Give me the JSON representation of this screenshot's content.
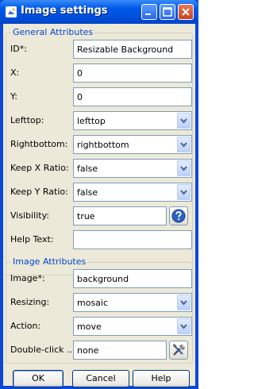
{
  "window": {
    "title": "Image settings"
  },
  "general": {
    "legend": "General Attributes",
    "id": {
      "label": "ID*:",
      "value": "Resizable Background"
    },
    "x": {
      "label": "X:",
      "value": "0"
    },
    "y": {
      "label": "Y:",
      "value": "0"
    },
    "lefttop": {
      "label": "Lefttop:",
      "value": "lefttop"
    },
    "rightbottom": {
      "label": "Rightbottom:",
      "value": "rightbottom"
    },
    "keepx": {
      "label": "Keep X Ratio:",
      "value": "false"
    },
    "keepy": {
      "label": "Keep Y Ratio:",
      "value": "false"
    },
    "visibility": {
      "label": "Visibility:",
      "value": "true",
      "icon": "help-icon"
    },
    "helptext": {
      "label": "Help Text:",
      "value": ""
    }
  },
  "image": {
    "legend": "Image Attributes",
    "image": {
      "label": "Image*:",
      "value": "background"
    },
    "resizing": {
      "label": "Resizing:",
      "value": "mosaic"
    },
    "action": {
      "label": "Action:",
      "value": "move"
    },
    "doubleclick": {
      "label": "Double-click ...",
      "value": "none",
      "icon": "tools-icon"
    }
  },
  "buttons": {
    "ok": "OK",
    "cancel": "Cancel",
    "help": "Help"
  },
  "colors": {
    "title_bar": "#0058e8",
    "client_bg": "#ece9d8",
    "legend_text": "#0046d5",
    "field_border": "#7f9db9"
  }
}
